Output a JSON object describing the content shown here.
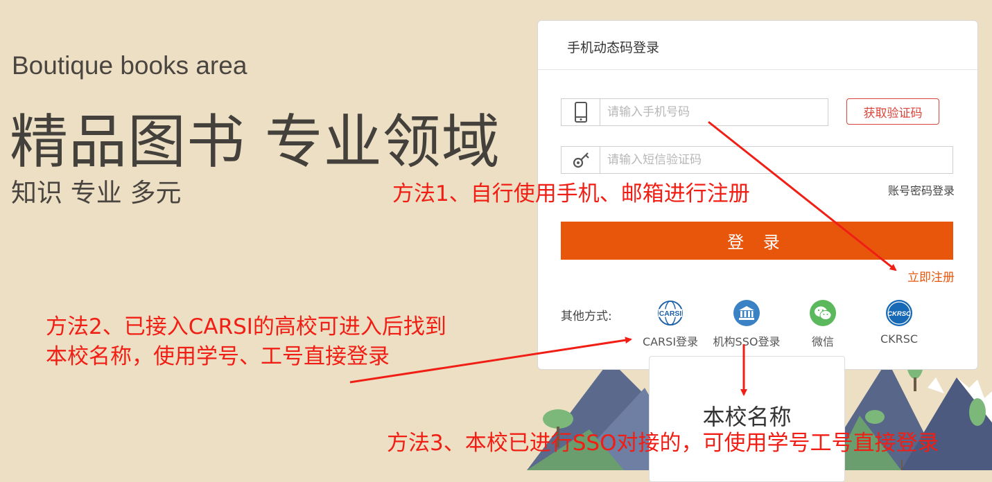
{
  "hero": {
    "english": "Boutique books area",
    "title": "精品图书  专业领域",
    "subtitle": "知识  专业  多元"
  },
  "login": {
    "tab_title": "手机动态码登录",
    "phone_placeholder": "请输入手机号码",
    "sms_placeholder": "请输入短信验证码",
    "get_code_label": "获取验证码",
    "password_login_label": "账号密码登录",
    "submit_label": "登 录",
    "register_label": "立即注册",
    "other_label": "其他方式:",
    "methods": [
      {
        "label": "CARSI登录",
        "icon": "carsi-icon",
        "color": "#1a5fa8"
      },
      {
        "label": "机构SSO登录",
        "icon": "institution-icon",
        "color": "#3b82c4"
      },
      {
        "label": "微信",
        "icon": "wechat-icon",
        "color": "#5cb85c"
      },
      {
        "label": "CKRSC",
        "icon": "ckrsc-icon",
        "color": "#1769b6"
      }
    ]
  },
  "popup": {
    "title": "本校名称"
  },
  "annotations": {
    "method1": "方法1、自行使用手机、邮箱进行注册",
    "method2_line1": "方法2、已接入CARSI的高校可进入后找到",
    "method2_line2": "本校名称，使用学号、工号直接登录",
    "method3": "方法3、本校已进行SSO对接的，可使用学号工号直接登录"
  },
  "colors": {
    "background": "#ecdfc3",
    "accent": "#e8560c",
    "annotation": "#f01e14"
  }
}
